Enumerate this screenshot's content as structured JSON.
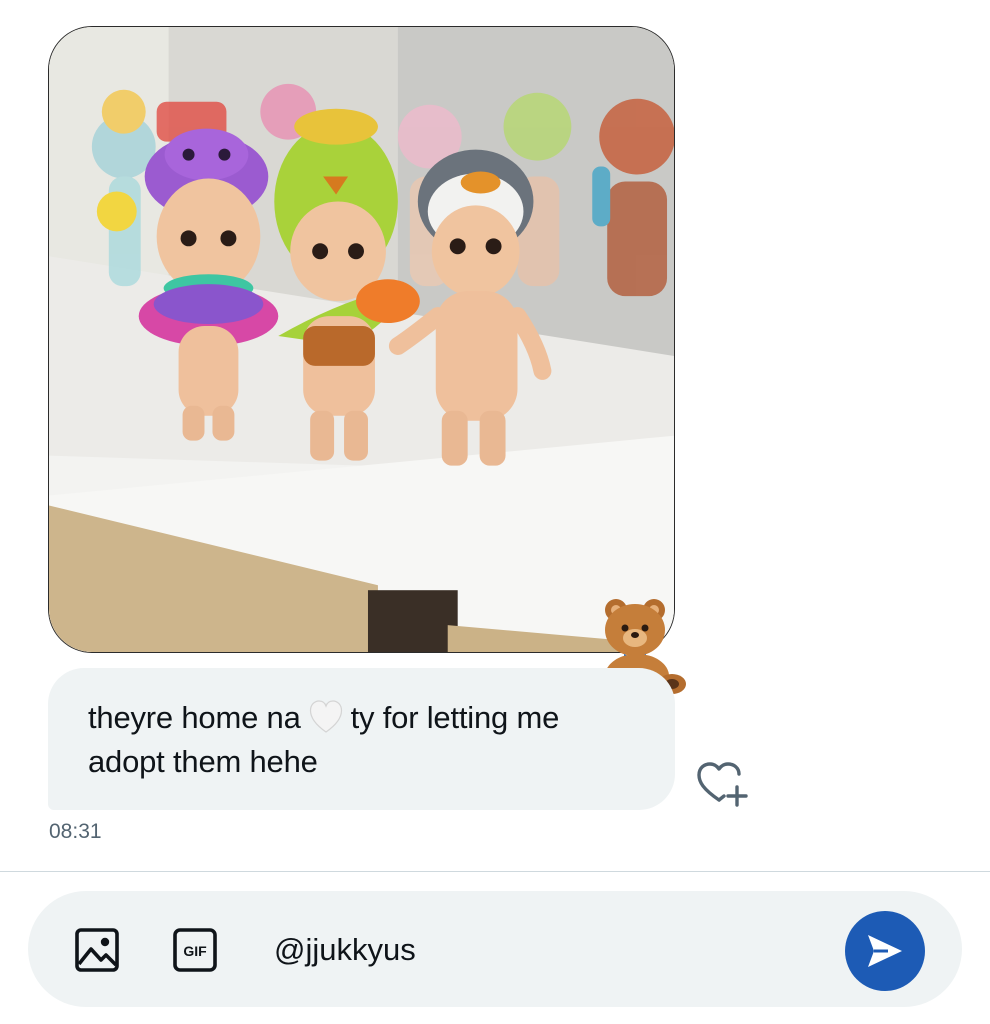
{
  "message": {
    "text_before_emoji": "theyre home na",
    "emoji": "white-heart",
    "text_after_emoji": "ty for letting me adopt them hehe",
    "timestamp": "08:31",
    "reaction": "teddy-bear"
  },
  "composer": {
    "value": "@jjukkyus",
    "media_icon": "image-icon",
    "gif_label": "GIF",
    "send_icon": "send-icon"
  },
  "colors": {
    "bubble": "#eff3f4",
    "send_button": "#1d5bb5",
    "timestamp": "#536471"
  }
}
